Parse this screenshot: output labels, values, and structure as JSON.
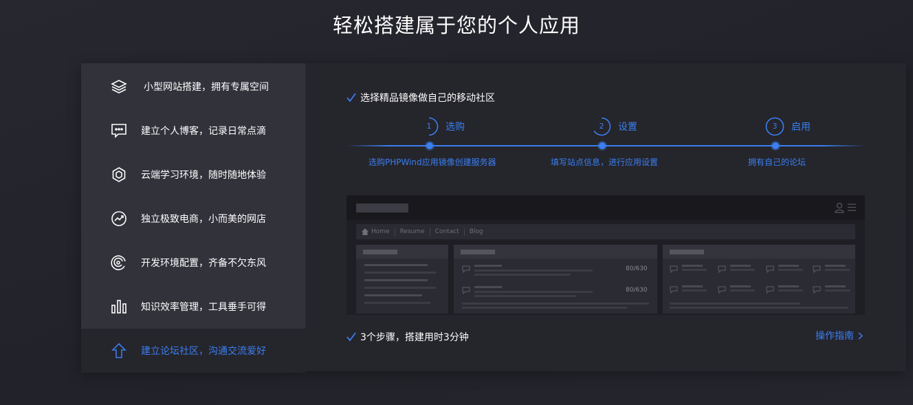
{
  "page": {
    "title": "轻松搭建属于您的个人应用"
  },
  "sidebar": {
    "items": [
      {
        "label": "小型网站搭建，拥有专属空间",
        "icon": "layers-icon"
      },
      {
        "label": "建立个人博客，记录日常点滴",
        "icon": "chat-icon"
      },
      {
        "label": "云端学习环境，随时随地体验",
        "icon": "hexagon-icon"
      },
      {
        "label": "独立极致电商，小而美的网店",
        "icon": "chart-circle-icon"
      },
      {
        "label": "开发环境配置，齐备不欠东风",
        "icon": "swirl-icon"
      },
      {
        "label": "知识效率管理，工具垂手可得",
        "icon": "bars-icon"
      },
      {
        "label": "建立论坛社区，沟通交流爱好",
        "icon": "arrow-up-icon",
        "active": true
      }
    ]
  },
  "content": {
    "intro": "选择精品镜像做自己的移动社区",
    "steps": [
      {
        "num": "1",
        "name": "选购",
        "desc": "选购PHPWind应用镜像创建服务器"
      },
      {
        "num": "2",
        "name": "设置",
        "desc": "填写站点信息，进行应用设置"
      },
      {
        "num": "3",
        "name": "启用",
        "desc": "拥有自己的论坛"
      }
    ],
    "preview": {
      "nav": [
        "Home",
        "Resume",
        "Contact",
        "Blog"
      ],
      "counts": [
        "80/630",
        "80/630"
      ]
    },
    "summary": "3个步骤，搭建用时3分钟",
    "guide_link": "操作指南"
  },
  "colors": {
    "accent": "#3b7ff0",
    "sidebar_bg": "#32323b",
    "panel_bg": "#25252c"
  }
}
